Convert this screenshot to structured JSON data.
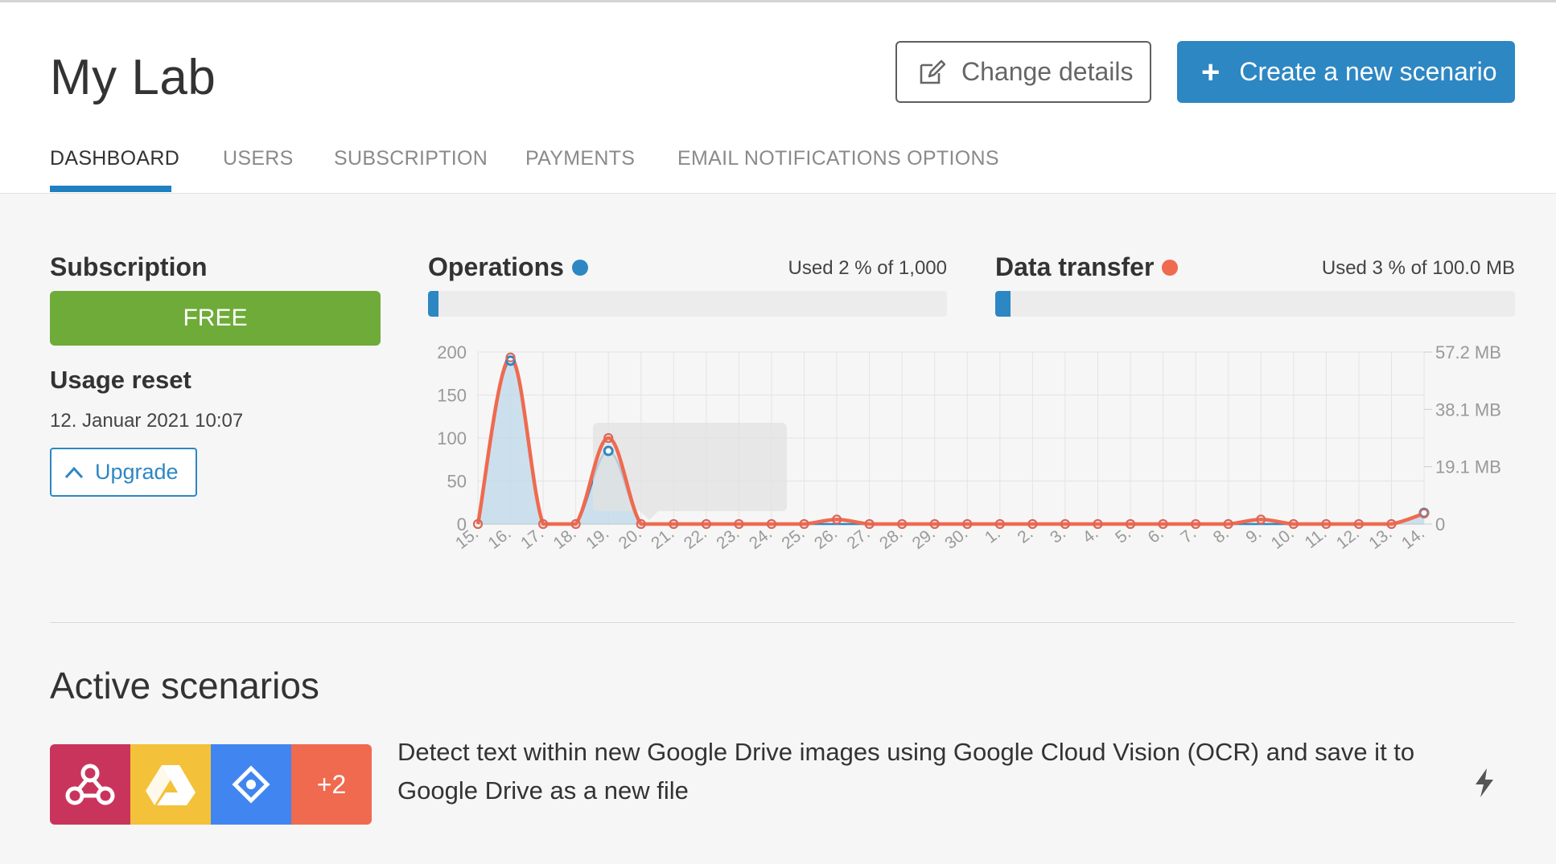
{
  "page": {
    "title": "My Lab"
  },
  "header": {
    "change_details_label": "Change details",
    "create_label": "Create a new scenario"
  },
  "tabs": [
    {
      "label": "DASHBOARD",
      "active": true
    },
    {
      "label": "USERS",
      "active": false
    },
    {
      "label": "SUBSCRIPTION",
      "active": false
    },
    {
      "label": "PAYMENTS",
      "active": false
    },
    {
      "label": "EMAIL NOTIFICATIONS OPTIONS",
      "active": false
    }
  ],
  "subscription": {
    "title": "Subscription",
    "plan": "FREE",
    "plan_color": "#6fab39",
    "usage_reset_title": "Usage reset",
    "usage_reset_date": "12. Januar 2021 10:07",
    "upgrade_label": "Upgrade"
  },
  "operations": {
    "title": "Operations",
    "color": "#2d87c3",
    "used_text": "Used 2 % of 1,000",
    "used_percent": 2
  },
  "data_transfer": {
    "title": "Data transfer",
    "color": "#ef6a4f",
    "used_text": "Used 3 % of 100.0 MB",
    "used_percent": 3
  },
  "chart_data": {
    "type": "area",
    "categories": [
      "15.",
      "16.",
      "17.",
      "18.",
      "19.",
      "20.",
      "21.",
      "22.",
      "23.",
      "24.",
      "25.",
      "26.",
      "27.",
      "28.",
      "29.",
      "30.",
      "1.",
      "2.",
      "3.",
      "4.",
      "5.",
      "6.",
      "7.",
      "8.",
      "9.",
      "10.",
      "11.",
      "12.",
      "13.",
      "14."
    ],
    "y_left_ticks": [
      "200",
      "150",
      "100",
      "50",
      "0"
    ],
    "y_left_range": [
      0,
      200
    ],
    "y_right_ticks": [
      "57.2 MB",
      "38.1 MB",
      "19.1 MB",
      "0"
    ],
    "y_right_range_mb": [
      0,
      57.2
    ],
    "grid": true,
    "series": [
      {
        "name": "Operations",
        "axis": "left",
        "color": "#2d87c3",
        "values": [
          0,
          190,
          0,
          0,
          85,
          0,
          0,
          0,
          0,
          0,
          0,
          0,
          0,
          0,
          0,
          0,
          0,
          0,
          0,
          0,
          0,
          0,
          0,
          0,
          0,
          0,
          0,
          0,
          0,
          13
        ]
      },
      {
        "name": "Data transfer",
        "axis": "right",
        "color": "#ef6a4f",
        "values": [
          0,
          55.4,
          0,
          0,
          28.6,
          0,
          0,
          0,
          0,
          0,
          0,
          1.5,
          0,
          0,
          0,
          0,
          0,
          0,
          0,
          0,
          0,
          0,
          0,
          0,
          1.5,
          0,
          0,
          0,
          0,
          3.5
        ]
      }
    ]
  },
  "active_scenarios": {
    "title": "Active scenarios",
    "items": [
      {
        "apps": [
          "webhook-icon",
          "google-drive-icon",
          "google-cloud-vision-icon"
        ],
        "more_count": "+2",
        "description": "Detect text within new Google Drive images using Google Cloud Vision (OCR) and save it to Google Drive as a new file"
      }
    ]
  }
}
